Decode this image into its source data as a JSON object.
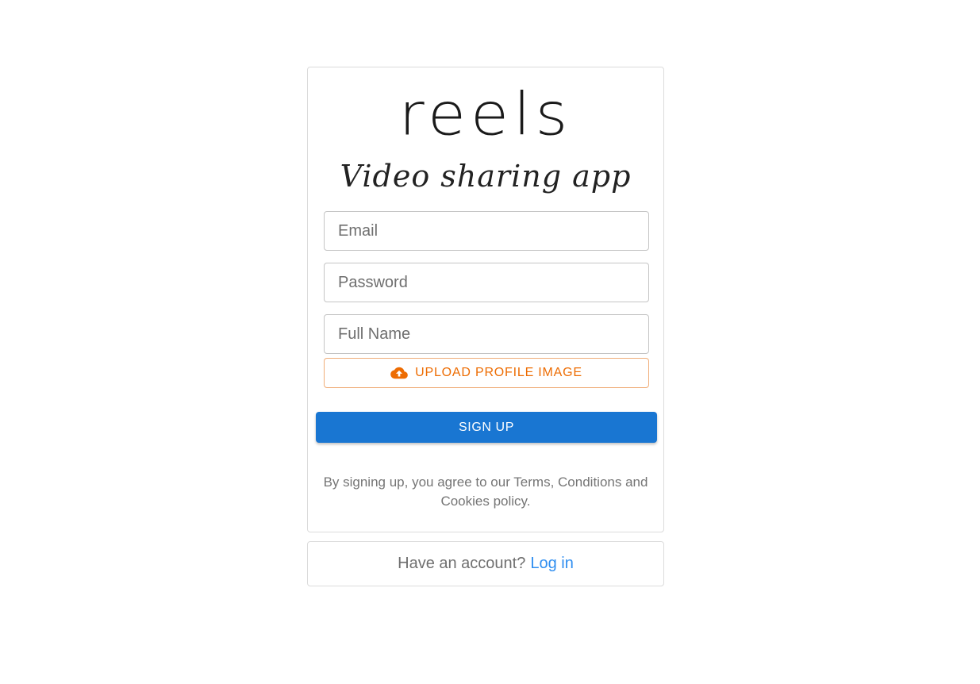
{
  "brand": {
    "logo": "reels",
    "tagline": "Video sharing app"
  },
  "form": {
    "email_placeholder": "Email",
    "password_placeholder": "Password",
    "fullname_placeholder": "Full Name",
    "upload_label": "UPLOAD PROFILE IMAGE",
    "upload_icon": "cloud-upload-icon",
    "signup_label": "SIGN UP",
    "terms": "By signing up, you agree to our Terms, Conditions and Cookies policy."
  },
  "footer": {
    "prompt": "Have an account?",
    "login_label": "Log in"
  },
  "colors": {
    "primary": "#1976d2",
    "warning": "#ed6c02",
    "link": "#2f8ef0",
    "border": "#dbdbdb"
  }
}
